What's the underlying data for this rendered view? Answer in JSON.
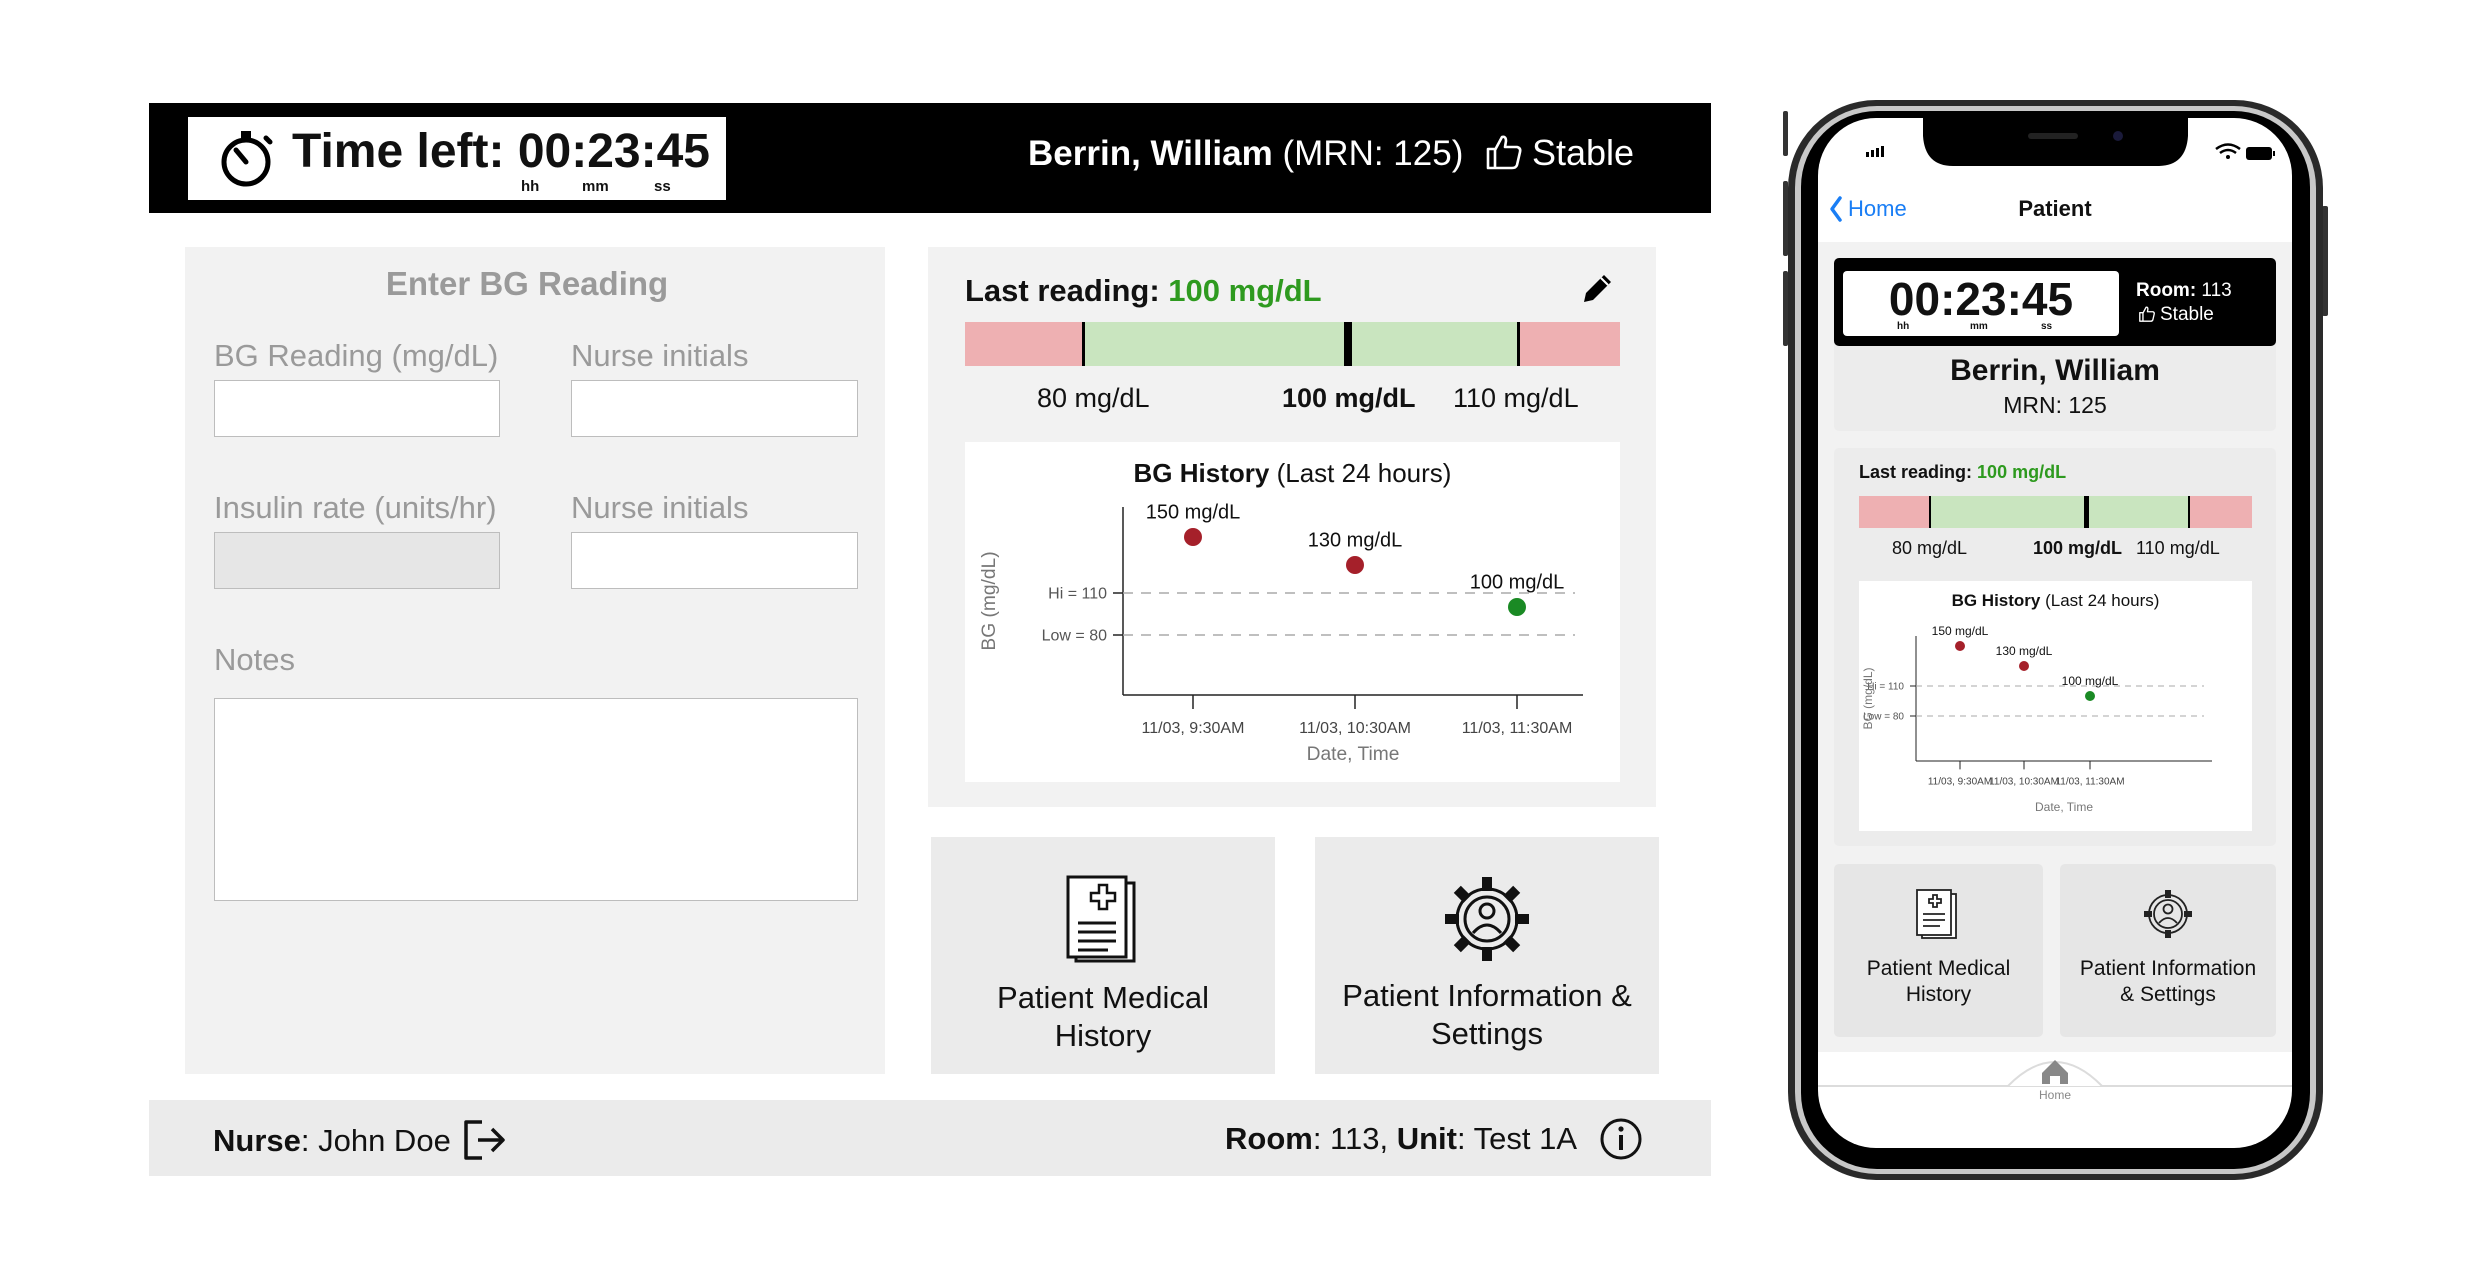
{
  "tablet": {
    "header": {
      "timer_label": "Time left:",
      "timer_value": "00:23:45",
      "units": [
        "hh",
        "mm",
        "ss"
      ],
      "patient_name": "Berrin, William",
      "mrn": "(MRN: 125)",
      "status": "Stable"
    },
    "form": {
      "title": "Enter BG Reading",
      "bg_label": "BG Reading (mg/dL)",
      "bg_value": "",
      "bg_initials_label": "Nurse initials",
      "bg_initials_value": "",
      "insulin_label": "Insulin rate (units/hr)",
      "insulin_value": "",
      "insulin_initials_label": "Nurse initials",
      "insulin_initials_value": "",
      "notes_label": "Notes",
      "notes_value": ""
    },
    "reading": {
      "last_label": "Last reading:",
      "last_value": "100 mg/dL",
      "range_low": "80 mg/dL",
      "range_mid": "100 mg/dL",
      "range_high": "110 mg/dL"
    },
    "tiles": {
      "medical_history": [
        "Patient Medical",
        "History"
      ],
      "info_settings": [
        "Patient Information &",
        "Settings"
      ]
    },
    "footer": {
      "nurse_label": "Nurse",
      "nurse_name": ": John Doe",
      "room_label": "Room",
      "room_value": ": 113, ",
      "unit_label": "Unit",
      "unit_value": ": Test 1A"
    }
  },
  "phone": {
    "nav_back": "Home",
    "nav_title": "Patient",
    "timer_value": "00:23:45",
    "units": [
      "hh",
      "mm",
      "ss"
    ],
    "room_label": "Room:",
    "room_value": " 113",
    "status": "Stable",
    "patient_name": "Berrin, William",
    "mrn": "MRN: 125",
    "last_label": "Last reading:",
    "last_value": "100 mg/dL",
    "range_low": "80 mg/dL",
    "range_mid": "100 mg/dL",
    "range_high": "110 mg/dL",
    "tiles": {
      "medical_history": [
        "Patient Medical",
        "History"
      ],
      "info_settings": [
        "Patient Information",
        "& Settings"
      ]
    },
    "tab_home": "Home"
  },
  "colors": {
    "in_range": "#c9e5bf",
    "out_of_range": "#eeb0b2",
    "high_point": "#a5202a",
    "normal_point": "#1a8a24",
    "last_value_text": "#2e9a1f",
    "header_bg": "#000000",
    "panel_bg": "#f2f2f2"
  },
  "chart_data": {
    "type": "scatter",
    "title": "BG History",
    "subtitle": "(Last 24 hours)",
    "xlabel": "Date, Time",
    "ylabel": "BG (mg/dL)",
    "categories": [
      "11/03, 9:30AM",
      "11/03, 10:30AM",
      "11/03, 11:30AM"
    ],
    "values": [
      150,
      130,
      100
    ],
    "point_labels": [
      "150 mg/dL",
      "130 mg/dL",
      "100 mg/dL"
    ],
    "point_status": [
      "high",
      "high",
      "normal"
    ],
    "reference_lines": [
      {
        "label": "Hi = 110",
        "value": 110
      },
      {
        "label": "Low = 80",
        "value": 80
      }
    ]
  }
}
